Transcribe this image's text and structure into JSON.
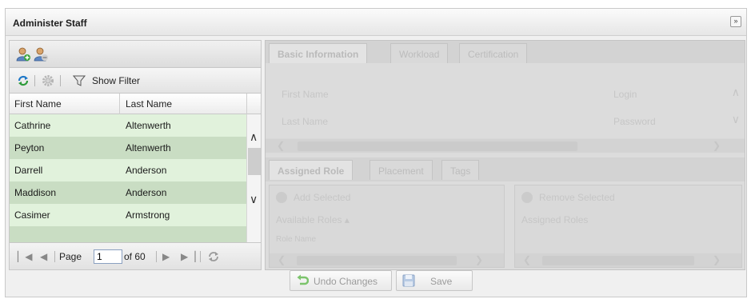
{
  "window": {
    "title": "Administer Staff"
  },
  "icons": {
    "collapse": "double-chevron-down-icon",
    "add_user": "add-user-icon",
    "remove_user": "remove-user-icon",
    "refresh": "refresh-icon",
    "settings": "gear-icon",
    "filter": "funnel-icon"
  },
  "toolbar": {
    "filter_label": "Show Filter"
  },
  "grid": {
    "columns": [
      "First Name",
      "Last Name"
    ],
    "rows": [
      {
        "first": "Cathrine",
        "last": "Altenwerth"
      },
      {
        "first": "Peyton",
        "last": "Altenwerth"
      },
      {
        "first": "Darrell",
        "last": "Anderson"
      },
      {
        "first": "Maddison",
        "last": "Anderson"
      },
      {
        "first": "Casimer",
        "last": "Armstrong"
      }
    ]
  },
  "pager": {
    "page_label": "Page",
    "page_value": "1",
    "of_label": "of 60"
  },
  "detail": {
    "tabs_top": [
      "Basic Information",
      "Workload",
      "Certification"
    ],
    "fields": {
      "first_name": "First Name",
      "last_name": "Last Name",
      "login": "Login",
      "password": "Password"
    },
    "tabs_bottom": [
      "Assigned Role",
      "Placement",
      "Tags"
    ],
    "add_selected": "Add Selected",
    "remove_selected": "Remove Selected",
    "available_roles": "Available Roles ▴",
    "assigned_roles": "Assigned Roles",
    "role_name": "Role Name"
  },
  "footer": {
    "undo_label": "Undo Changes",
    "save_label": "Save"
  },
  "colors": {
    "row_even": "#e1f2dc",
    "row_odd": "#c9ddc3",
    "disabled_bg": "#dcdcdc"
  }
}
